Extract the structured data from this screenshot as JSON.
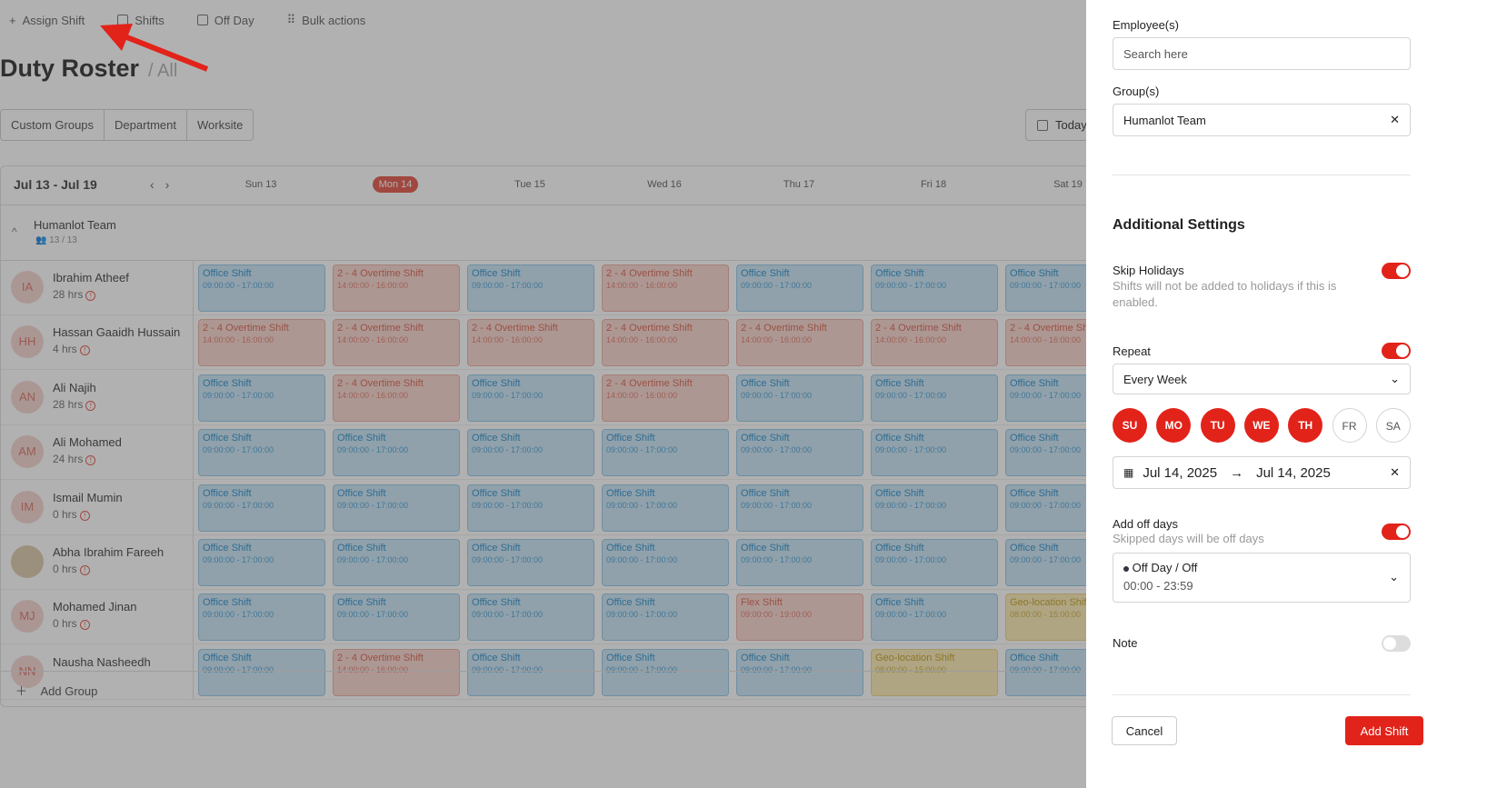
{
  "toolbar": {
    "assign": "Assign Shift",
    "shifts": "Shifts",
    "offday": "Off Day",
    "bulk": "Bulk actions"
  },
  "page": {
    "title": "Duty Roster",
    "subtitle": "/ All"
  },
  "filters": [
    "Custom Groups",
    "Department",
    "Worksite"
  ],
  "today_label": "Today",
  "week": {
    "range": "Jul 13 - Jul 19",
    "days": [
      "Sun 13",
      "Mon 14",
      "Tue 15",
      "Wed 16",
      "Thu 17",
      "Fri 18",
      "Sat 19"
    ],
    "active_day": 1
  },
  "group": {
    "name": "Humanlot Team",
    "count": "13 / 13"
  },
  "employees": [
    {
      "initials": "IA",
      "name": "Ibrahim Atheef",
      "hours": "28 hrs"
    },
    {
      "initials": "HH",
      "name": "Hassan Gaaidh Hussain",
      "hours": "4 hrs"
    },
    {
      "initials": "AN",
      "name": "Ali Najih",
      "hours": "28 hrs"
    },
    {
      "initials": "AM",
      "name": "Ali Mohamed",
      "hours": "24 hrs"
    },
    {
      "initials": "IM",
      "name": "Ismail Mumin",
      "hours": "0 hrs"
    },
    {
      "initials": "",
      "name": "Abha Ibrahim Fareeh",
      "hours": "0 hrs"
    },
    {
      "initials": "MJ",
      "name": "Mohamed Jinan",
      "hours": "0 hrs"
    },
    {
      "initials": "NN",
      "name": "Nausha Nasheedh",
      "hours": ""
    }
  ],
  "shift_types": {
    "office": {
      "name": "Office Shift",
      "time": "09:00:00 - 17:00:00"
    },
    "ot": {
      "name": "2 - 4 Overtime Shift",
      "time": "14:00:00 - 16:00:00"
    },
    "flex": {
      "name": "Flex Shift",
      "time": "09:00:00 - 19:00:00"
    },
    "geo": {
      "name": "Geo-location Shift",
      "time": "08:00:00 - 15:00:00"
    }
  },
  "schedule": [
    [
      "office",
      "ot",
      "office",
      "ot",
      "office",
      "office",
      "office"
    ],
    [
      "ot",
      "ot",
      "ot",
      "ot",
      "ot",
      "ot",
      "ot"
    ],
    [
      "office",
      "ot",
      "office",
      "ot",
      "office",
      "office",
      "office"
    ],
    [
      "office",
      "office",
      "office",
      "office",
      "office",
      "office",
      "office"
    ],
    [
      "office",
      "office",
      "office",
      "office",
      "office",
      "office",
      "office"
    ],
    [
      "office",
      "office",
      "office",
      "office",
      "office",
      "office",
      "office"
    ],
    [
      "office",
      "office",
      "office",
      "office",
      "flex",
      "office",
      "geo"
    ],
    [
      "office",
      "ot",
      "office",
      "office",
      "office",
      "geo",
      "office"
    ]
  ],
  "add_group": "Add Group",
  "panel": {
    "employees_label": "Employee(s)",
    "search_placeholder": "Search here",
    "groups_label": "Group(s)",
    "group_value": "Humanlot Team",
    "additional_settings": "Additional Settings",
    "skip_holidays": {
      "label": "Skip Holidays",
      "hint": "Shifts will not be added to holidays if this is enabled.",
      "enabled": true
    },
    "repeat": {
      "label": "Repeat",
      "enabled": true,
      "value": "Every Week"
    },
    "days": [
      {
        "label": "SU",
        "on": true
      },
      {
        "label": "MO",
        "on": true
      },
      {
        "label": "TU",
        "on": true
      },
      {
        "label": "WE",
        "on": true
      },
      {
        "label": "TH",
        "on": true
      },
      {
        "label": "FR",
        "on": false
      },
      {
        "label": "SA",
        "on": false
      }
    ],
    "date_start": "Jul 14, 2025",
    "date_end": "Jul 14, 2025",
    "add_off_days": {
      "label": "Add off days",
      "hint": "Skipped days will be off days",
      "enabled": true
    },
    "off_day_select": {
      "title": "Off Day /",
      "sub": "Off",
      "time": "00:00 - 23:59"
    },
    "note": {
      "label": "Note",
      "enabled": false
    },
    "cancel": "Cancel",
    "add_shift": "Add Shift"
  }
}
